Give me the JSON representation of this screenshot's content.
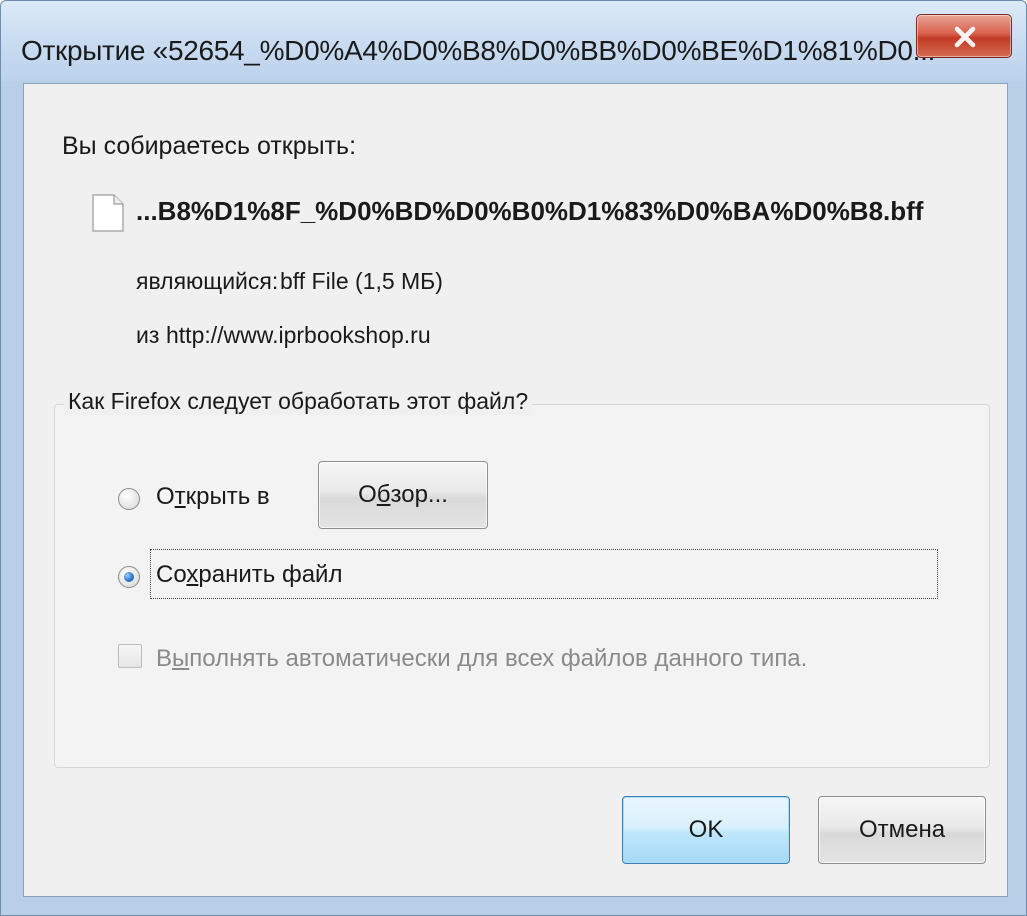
{
  "window": {
    "title": "Открытие «52654_%D0%A4%D0%B8%D0%BB%D0%BE%D1%81%D0..."
  },
  "intro": {
    "label": "Вы собираетесь открыть:"
  },
  "file": {
    "name": "...B8%D1%8F_%D0%BD%D0%B0%D1%83%D0%BA%D0%B8.bff",
    "type_label": "являющийся:",
    "type_value": "bff File (1,5 МБ)",
    "source_label": "из",
    "source_value": "http://www.iprbookshop.ru"
  },
  "action_group": {
    "legend": "Как Firefox следует обработать этот файл?",
    "open_with": {
      "label_before": "О",
      "label_underlined": "т",
      "label_after": "крыть в",
      "selected": false
    },
    "browse_button": {
      "label_before": "О",
      "label_underlined": "б",
      "label_after": "зор..."
    },
    "save_file": {
      "label_before": "Со",
      "label_underlined": "х",
      "label_after": "ранить файл",
      "selected": true
    },
    "auto_checkbox": {
      "label_before": "В",
      "label_underlined": "ы",
      "label_after": "полнять автоматически для всех файлов данного типа.",
      "checked": false,
      "enabled": false
    }
  },
  "buttons": {
    "ok": "OK",
    "cancel": "Отмена"
  },
  "colors": {
    "title_gradient_top": "#dceaf8",
    "close_button": "#c23b26",
    "client_bg": "#f0f0f0",
    "disabled_text": "#8a8a8a",
    "radio_selected": "#2b79c9"
  },
  "icons": {
    "close": "close-icon",
    "file": "document-icon"
  }
}
